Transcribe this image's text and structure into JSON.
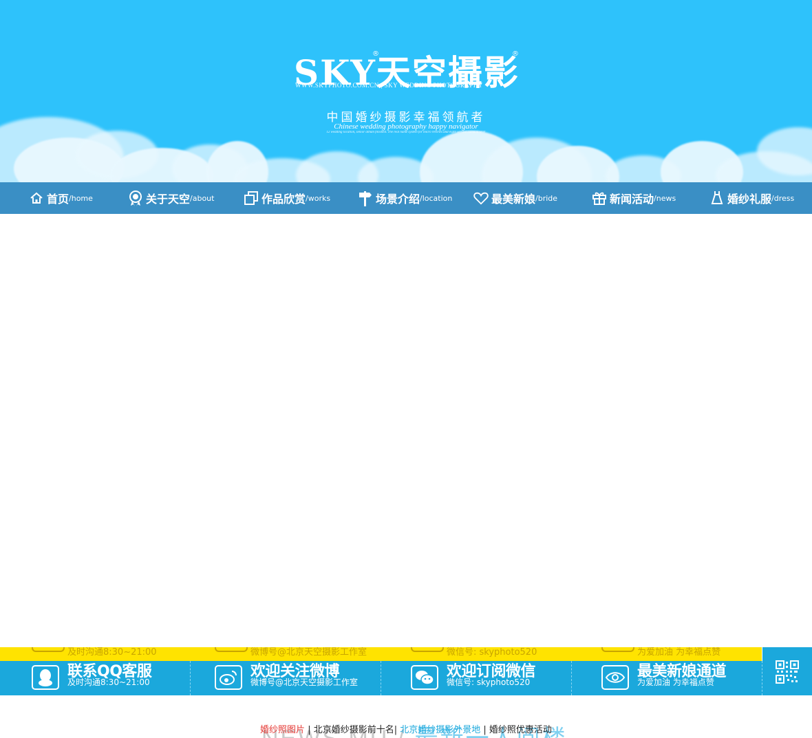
{
  "colors": {
    "sky": "#2ec2fb",
    "nav": "#3a8fc5",
    "footer": "#1ba8dc",
    "yellow": "#ffe300",
    "link_red": "#e53935",
    "link_blue": "#1ba8dc"
  },
  "header": {
    "logo_text": "SKY天空攝影",
    "logo_sub": "WWW.SKYPHOTO.COM.CN | SKY WEDDING PHOTOGRAPHY",
    "slogan_cn": "中国婚纱摄影幸福领航者",
    "slogan_en": "Chinese wedding photography happy navigator",
    "slogan_tiny": "12 wedding location, senior album finished. The real name system for micro reviews and eight service commitment!"
  },
  "nav": {
    "items": [
      {
        "cn": "首页",
        "en": "/home",
        "icon": "home-icon"
      },
      {
        "cn": "关于天空",
        "en": "/about",
        "icon": "badge-icon"
      },
      {
        "cn": "作品欣赏",
        "en": "/works",
        "icon": "gallery-icon"
      },
      {
        "cn": "场景介绍",
        "en": "/location",
        "icon": "signpost-icon"
      },
      {
        "cn": "最美新娘",
        "en": "/bride",
        "icon": "heart-icon"
      },
      {
        "cn": "新闻活动",
        "en": "/news",
        "icon": "gift-icon"
      },
      {
        "cn": "婚纱礼服",
        "en": "/dress",
        "icon": "dress-icon"
      }
    ]
  },
  "footer": {
    "ghost": [
      "及时沟通8:30~21:00",
      "微博号@北京天空摄影工作室",
      "微信号: skyphoto520",
      "为爱加油  为幸福点赞"
    ],
    "cells": [
      {
        "title": "联系QQ客服",
        "sub": "及时沟通8:30~21:00",
        "icon": "qq-icon"
      },
      {
        "title": "欢迎关注微博",
        "sub": "微博号@北京天空摄影工作室",
        "icon": "weibo-icon"
      },
      {
        "title": "欢迎订阅微信",
        "sub": "微信号: skyphoto520",
        "icon": "wechat-icon"
      },
      {
        "title": "最美新娘通道",
        "sub": "为爱加油  为幸福点赞",
        "icon": "eye-icon"
      }
    ]
  },
  "bottom": {
    "ghost_left": "NEWS MU / ",
    "ghost_right": "最新一人阅楼",
    "links": [
      {
        "text": "婚纱照图片",
        "color": "#e53935"
      },
      {
        "text": "北京婚纱摄影前十名",
        "color": "#222222"
      },
      {
        "text": "北京婚纱摄影外景地",
        "color": "#1ba8dc"
      },
      {
        "text": "婚纱照优惠活动",
        "color": "#222222"
      }
    ],
    "sep1": " | ",
    "sep2": "| ",
    "sep3": " | "
  }
}
